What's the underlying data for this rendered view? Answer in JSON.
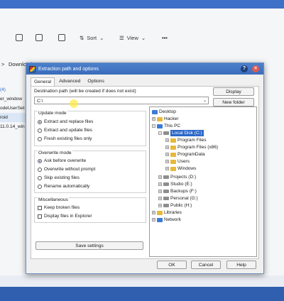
{
  "explorer": {
    "toolbar": {
      "sort": "Sort",
      "view": "View",
      "more": "•••"
    },
    "address": {
      "arrow": ">",
      "path": "Downloads"
    },
    "sidebar_fragments": [
      "(4)",
      "er_window",
      "odeUserSet",
      "roid",
      "11.0.14_win"
    ]
  },
  "dialog": {
    "title": "Extraction path and options",
    "help": "?",
    "close": "×",
    "tabs": [
      "General",
      "Advanced",
      "Options"
    ],
    "dest_label": "Destination path (will be created if does not exist)",
    "dest_value": "C:\\",
    "display_button": "Display",
    "new_folder_button": "New folder",
    "update_mode": {
      "title": "Update mode",
      "options": [
        "Extract and replace files",
        "Extract and update files",
        "Fresh existing files only"
      ],
      "selected": 0
    },
    "overwrite_mode": {
      "title": "Overwrite mode",
      "options": [
        "Ask before overwrite",
        "Overwrite without prompt",
        "Skip existing files",
        "Rename automatically"
      ],
      "selected": 0
    },
    "misc": {
      "title": "Miscellaneous",
      "options": [
        "Keep broken files",
        "Display files in Explorer"
      ]
    },
    "save_settings": "Save settings",
    "tree": {
      "desktop": "Desktop",
      "hacker": "Hacker",
      "this_pc": "This PC",
      "local_disk": "Local Disk (C:)",
      "children": [
        "Program Files",
        "Program Files (x86)",
        "ProgramData",
        "Users",
        "Windows"
      ],
      "drives": [
        "Projects (D:)",
        "Studio (E:)",
        "Backups (F:)",
        "Personal (G:)",
        "Public (H:)"
      ],
      "libraries": "Libraries",
      "network": "Network"
    },
    "ok": "OK",
    "cancel": "Cancel",
    "help_button": "Help"
  }
}
